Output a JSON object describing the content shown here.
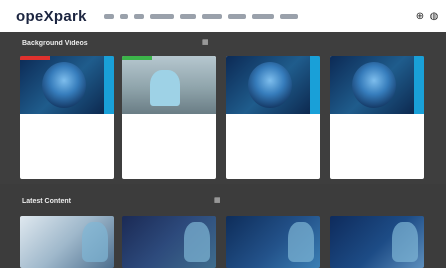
{
  "app": {
    "logo": "opeXpark"
  },
  "header": {
    "nav_items": [
      "",
      "",
      "",
      "",
      "",
      "",
      "",
      "",
      ""
    ],
    "icons": [
      {
        "name": "user-add-icon",
        "glyph": "⊕"
      },
      {
        "name": "user-icon",
        "glyph": "◍"
      }
    ]
  },
  "sections": [
    {
      "title": "Background Videos",
      "filter_label": "",
      "cards": [
        {
          "title": "",
          "meta1": "",
          "meta2": "",
          "link": "",
          "thumb": "brain",
          "badge": "red"
        },
        {
          "title": "",
          "meta1": "",
          "meta2": "",
          "link": "",
          "thumb": "surgeon",
          "badge": "green"
        },
        {
          "title": "",
          "meta1": "",
          "meta2": "",
          "link": "",
          "thumb": "brain",
          "badge": ""
        },
        {
          "title": "",
          "meta1": "",
          "meta2": "",
          "link": "",
          "thumb": "brain",
          "badge": ""
        }
      ]
    },
    {
      "title": "Latest Content",
      "filter_label": "",
      "videos": [
        {
          "title": ""
        },
        {
          "title": ""
        },
        {
          "title": ""
        },
        {
          "title": ""
        }
      ]
    }
  ],
  "colors": {
    "section_bg": "#3e3e3e",
    "accent_blue": "#19a0d8",
    "badge_red": "#e0312d",
    "badge_green": "#3cb44a"
  }
}
